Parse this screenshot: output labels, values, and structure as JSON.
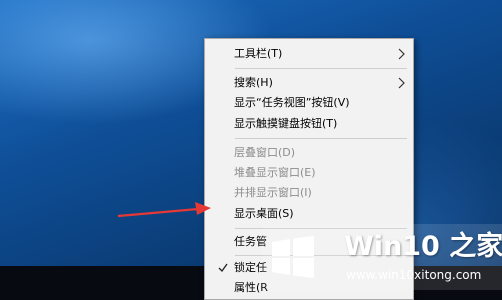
{
  "context_menu": {
    "items": [
      {
        "label": "工具栏(T)",
        "submenu": true
      },
      {
        "label": "搜索(H)",
        "submenu": true
      },
      {
        "label": "显示“任务视图”按钮(V)"
      },
      {
        "label": "显示触摸键盘按钮(T)"
      },
      {
        "label": "层叠窗口(D)",
        "disabled": true
      },
      {
        "label": "堆叠显示窗口(E)",
        "disabled": true
      },
      {
        "label": "并排显示窗口(I)",
        "disabled": true
      },
      {
        "label": "显示桌面(S)"
      },
      {
        "label": "任务管"
      },
      {
        "label": "锁定任",
        "checked": true
      },
      {
        "label": "属性(R"
      }
    ]
  },
  "icons": {
    "submenu": "chevron-right-icon",
    "check": "check-mark-icon",
    "pointer": "red-arrow-annotation",
    "logo": "windows-logo-icon"
  },
  "watermark": {
    "title": "Win10 之家",
    "url": "www.win10xitong.com"
  },
  "colors": {
    "desktop": "#1d6fc4",
    "menu_bg": "#f2f2f2",
    "disabled_text": "#8c8c8c",
    "arrow": "#e53935",
    "taskbar": "#070a10",
    "logo": "#ffffff"
  }
}
